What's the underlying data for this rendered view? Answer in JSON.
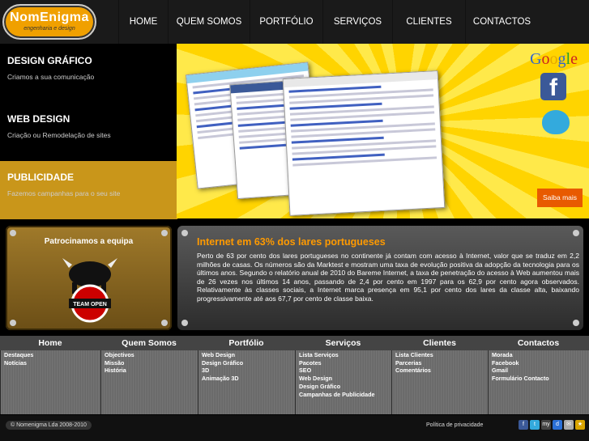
{
  "logo": {
    "name": "NomEnigma",
    "tagline": "engenharia e design"
  },
  "nav": [
    "HOME",
    "QUEM SOMOS",
    "PORTFÓLIO",
    "SERVIÇOS",
    "CLIENTES",
    "CONTACTOS"
  ],
  "services": [
    {
      "title": "DESIGN GRÁFICO",
      "subtitle": "Criamos a sua comunicação"
    },
    {
      "title": "WEB DESIGN",
      "subtitle": "Criação ou Remodelação de sites"
    },
    {
      "title": "PUBLICIDADE",
      "subtitle": "Fazemos campanhas para o seu site"
    }
  ],
  "banner": {
    "google": "Google",
    "facebook": "f",
    "button": "Saiba mais"
  },
  "sponsor": {
    "title": "Patrocinamos a equipa",
    "team": "TEAM OPEN"
  },
  "news": {
    "title": "Internet em 63% dos lares portugueses",
    "body": "Perto de 63 por cento dos lares portugueses no continente já contam com acesso à Internet, valor que se traduz em 2,2 milhões de casas. Os números são da Marktest e mostram uma taxa de evolução positiva da adopção da tecnologia para os últimos anos. Segundo o relatório anual de 2010 do Bareme Internet, a taxa de penetração do acesso à Web aumentou mais de 26 vezes nos últimos 14 anos, passando de 2,4 por cento em 1997 para os 62,9 por cento agora observados. Relativamente às classes sociais, a Internet marca presença em 95,1 por cento dos lares da classe alta, baixando progressivamente até aos 67,7 por cento de classe baixa."
  },
  "sitemap": [
    {
      "heading": "Home",
      "items": [
        "Destaques",
        "Notícias"
      ]
    },
    {
      "heading": "Quem Somos",
      "items": [
        "Objectivos",
        "Missão",
        "História"
      ]
    },
    {
      "heading": "Portfólio",
      "items": [
        "Web Design",
        "Design Gráfico",
        "3D",
        "Animação 3D"
      ]
    },
    {
      "heading": "Serviços",
      "items": [
        "Lista Serviços",
        "Pacotes",
        "SEO",
        "Web Design",
        "Design Gráfico",
        "Campanhas de Publicidade"
      ]
    },
    {
      "heading": "Clientes",
      "items": [
        "Lista Clientes",
        "Parcerias",
        "Comentários"
      ]
    },
    {
      "heading": "Contactos",
      "items": [
        "Morada",
        "Facebook",
        "Gmail",
        "Formulário Contacto"
      ]
    }
  ],
  "footer": {
    "copyright": "© Nomenigma Lda 2008-2010",
    "privacy": "Política de privacidade"
  },
  "social_icons": [
    {
      "name": "facebook-icon",
      "glyph": "f",
      "color": "#3b5998"
    },
    {
      "name": "twitter-icon",
      "glyph": "t",
      "color": "#33aadd"
    },
    {
      "name": "myspace-icon",
      "glyph": "my",
      "color": "#444"
    },
    {
      "name": "delicious-icon",
      "glyph": "d",
      "color": "#2a6fd6"
    },
    {
      "name": "email-icon",
      "glyph": "✉",
      "color": "#aaa"
    },
    {
      "name": "favorite-icon",
      "glyph": "★",
      "color": "#d9a400"
    }
  ],
  "colors": {
    "accent": "#ff9a00",
    "banner_yellow": "#ffd400",
    "button": "#e85a00"
  }
}
